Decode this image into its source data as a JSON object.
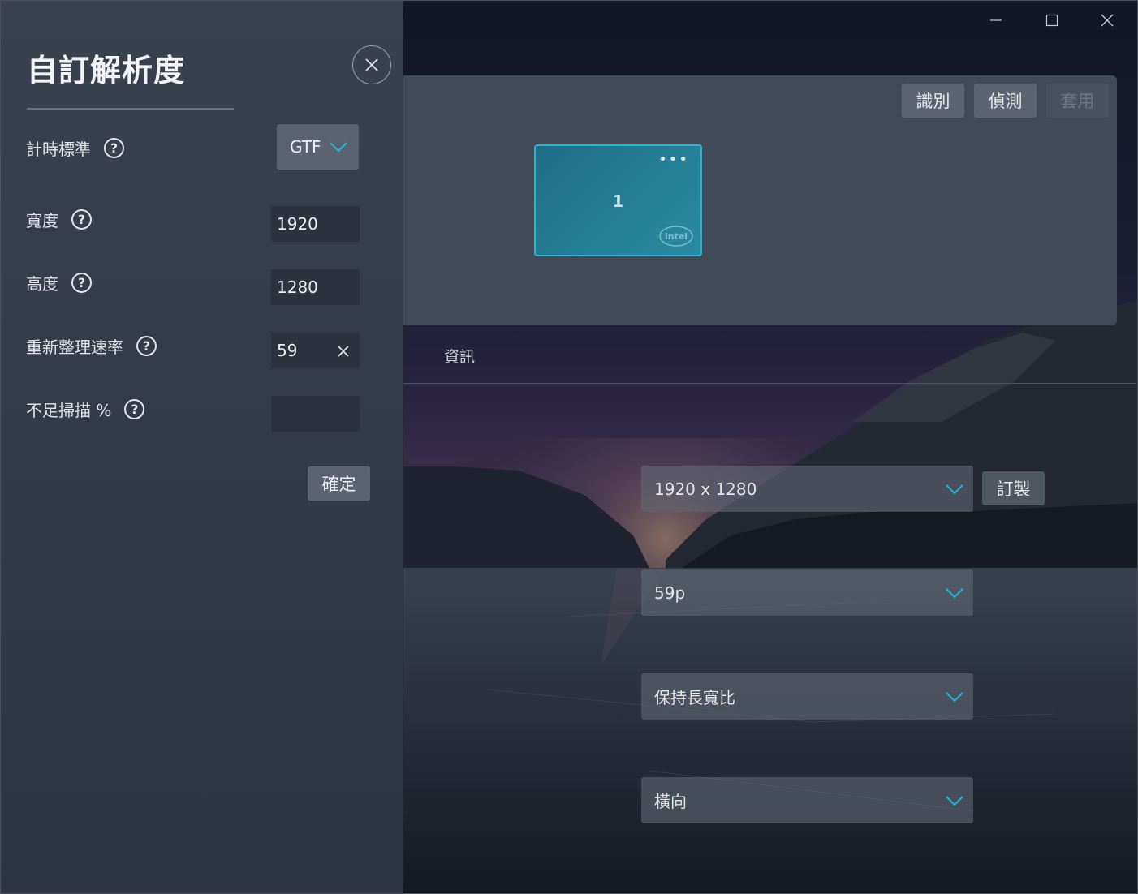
{
  "window": {
    "minimize_icon": "minimize-icon",
    "maximize_icon": "maximize-icon",
    "close_icon": "close-icon"
  },
  "display_panel": {
    "buttons": {
      "identify": "識別",
      "detect": "偵測",
      "apply": "套用"
    },
    "monitor": {
      "number": "1",
      "menu_dots": "•••",
      "logo": "intel"
    }
  },
  "tabs": {
    "info": "資訊"
  },
  "settings": {
    "resolution": "1920 x 1280",
    "custom_button": "訂製",
    "refresh_rate": "59p",
    "scaling": "保持長寬比",
    "orientation": "橫向"
  },
  "dialog": {
    "title": "自訂解析度",
    "timing_standard": {
      "label": "計時標準",
      "value": "GTF"
    },
    "width": {
      "label": "寬度",
      "value": "1920"
    },
    "height": {
      "label": "高度",
      "value": "1280"
    },
    "refresh_rate": {
      "label": "重新整理速率",
      "value": "59"
    },
    "underscan": {
      "label": "不足掃描 %",
      "value": ""
    },
    "help_symbol": "?",
    "confirm": "確定"
  },
  "colors": {
    "accent": "#2fb4cf",
    "chevron": "#22b7d8",
    "dialog_bg": "#343c49"
  }
}
